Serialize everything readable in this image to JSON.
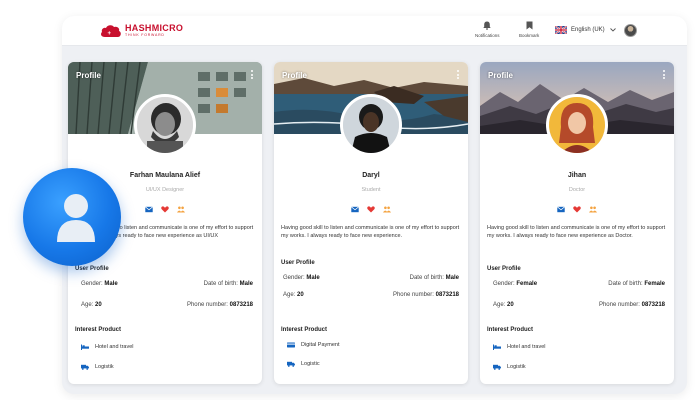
{
  "header": {
    "logo_name": "HASHMICRO",
    "logo_tagline": "THINK FORWARD",
    "notifications_label": "Notifications",
    "bookmark_label": "Bookmark",
    "language_label": "English (UK)",
    "icons": [
      "bell-icon",
      "bookmark-icon",
      "uk-flag-icon",
      "chevron-down-icon",
      "user-avatar"
    ]
  },
  "colors": {
    "brand": "#c8102e",
    "mail": "#1565c0",
    "heart": "#e53935",
    "people": "#f4a340",
    "bubble": "#1778e8"
  },
  "cards": [
    {
      "header": "Profile",
      "name": "Farhan Maulana Alief",
      "role": "UI/UX Designer",
      "bio": "Having good skill to listen and communicate is one of my effort to support my works. I always ready to face new experience as UI/UX",
      "user_profile_title": "User Profile",
      "gender_label": "Gender:",
      "gender": "Male",
      "dob_label": "Date of birth:",
      "dob": "Male",
      "age_label": "Age:",
      "age": "20",
      "phone_label": "Phone number:",
      "phone": "0873218",
      "interest_title": "Interest Product",
      "products": [
        {
          "icon": "bed-icon",
          "label": "Hotel and travel"
        },
        {
          "icon": "truck-icon",
          "label": "Logistik"
        }
      ]
    },
    {
      "header": "Profile",
      "name": "Daryl",
      "role": "Student",
      "bio": "Having good skill to listen and communicate is one of my effort to support my works. I always ready to face new experience.",
      "user_profile_title": "User Profile",
      "gender_label": "Gender:",
      "gender": "Male",
      "dob_label": "Date of birth:",
      "dob": "Male",
      "age_label": "Age:",
      "age": "20",
      "phone_label": "Phone number:",
      "phone": "0873218",
      "interest_title": "Interest Product",
      "products": [
        {
          "icon": "payment-card-icon",
          "label": "Digital Payment"
        },
        {
          "icon": "truck-icon",
          "label": "Logistic"
        }
      ]
    },
    {
      "header": "Profile",
      "name": "Jihan",
      "role": "Doctor",
      "bio": "Having good skill to listen and communicate is one of my effort to support my works. I always ready to face new experience as Doctor.",
      "user_profile_title": "User Profile",
      "gender_label": "Gender:",
      "gender": "Female",
      "dob_label": "Date of birth:",
      "dob": "Female",
      "age_label": "Age:",
      "age": "20",
      "phone_label": "Phone number:",
      "phone": "0873218",
      "interest_title": "Interest Product",
      "products": [
        {
          "icon": "bed-icon",
          "label": "Hotel and travel"
        },
        {
          "icon": "truck-icon",
          "label": "Logistik"
        }
      ]
    }
  ]
}
